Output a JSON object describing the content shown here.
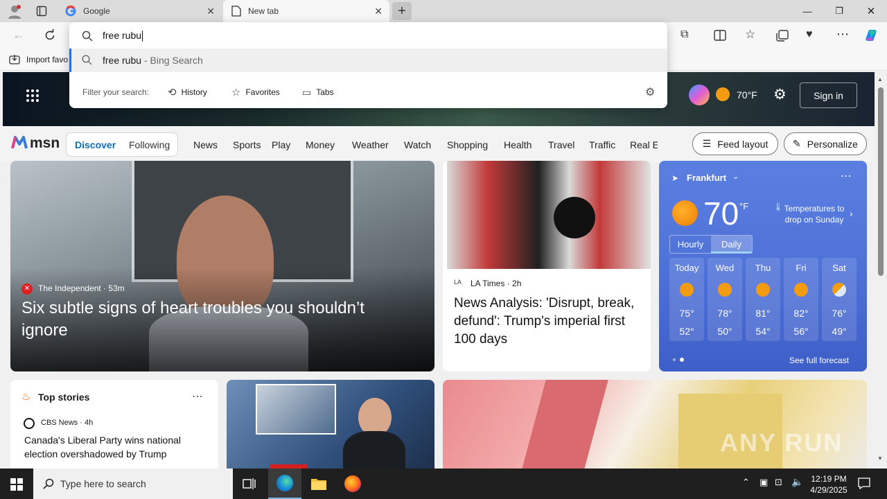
{
  "browser": {
    "tabs": [
      {
        "title": "Google",
        "favicon": "google-icon"
      },
      {
        "title": "New tab",
        "favicon": "page-icon"
      }
    ],
    "favorites_bar": {
      "import_label": "Import favo"
    },
    "address": {
      "typed": "free rubu",
      "suggestion_query": "free rubu",
      "suggestion_suffix": "- Bing Search",
      "filter_label": "Filter your search:",
      "filters": [
        "History",
        "Favorites",
        "Tabs"
      ]
    }
  },
  "msn": {
    "logo": "msn",
    "weather_chip": "70°F",
    "signin": "Sign in",
    "tabs": [
      "Discover",
      "Following"
    ],
    "nav": [
      "News",
      "Sports",
      "Play",
      "Money",
      "Weather",
      "Watch",
      "Shopping",
      "Health",
      "Travel",
      "Traffic",
      "Real E"
    ],
    "feed_layout": "Feed layout",
    "personalize": "Personalize",
    "hero": {
      "source": "The Independent",
      "age": "53m",
      "headline": "Six subtle signs of heart troubles you shouldn’t ignore"
    },
    "article2": {
      "source": "LA Times",
      "age": "2h",
      "headline": "News Analysis: 'Disrupt, break, defund': Trump's imperial first 100 days"
    },
    "weather": {
      "city": "Frankfurt",
      "temp": "70",
      "unit": "°F",
      "alert": "Temperatures to drop on Sunday",
      "toggle": [
        "Hourly",
        "Daily"
      ],
      "days": [
        {
          "day": "Today",
          "high": "75°",
          "low": "52°",
          "icon": "sun"
        },
        {
          "day": "Wed",
          "high": "78°",
          "low": "50°",
          "icon": "sun"
        },
        {
          "day": "Thu",
          "high": "81°",
          "low": "54°",
          "icon": "sun"
        },
        {
          "day": "Fri",
          "high": "82°",
          "low": "56°",
          "icon": "sun"
        },
        {
          "day": "Sat",
          "high": "76°",
          "low": "49°",
          "icon": "partly-cloudy"
        }
      ],
      "see_full": "See full forecast"
    },
    "top_stories": {
      "title": "Top stories",
      "source": "CBS News",
      "age": "4h",
      "headline": "Canada's Liberal Party wins national election overshadowed by Trump"
    },
    "watermark": "ANY RUN"
  },
  "taskbar": {
    "search_placeholder": "Type here to search",
    "time": "12:19 PM",
    "date": "4/29/2025"
  }
}
